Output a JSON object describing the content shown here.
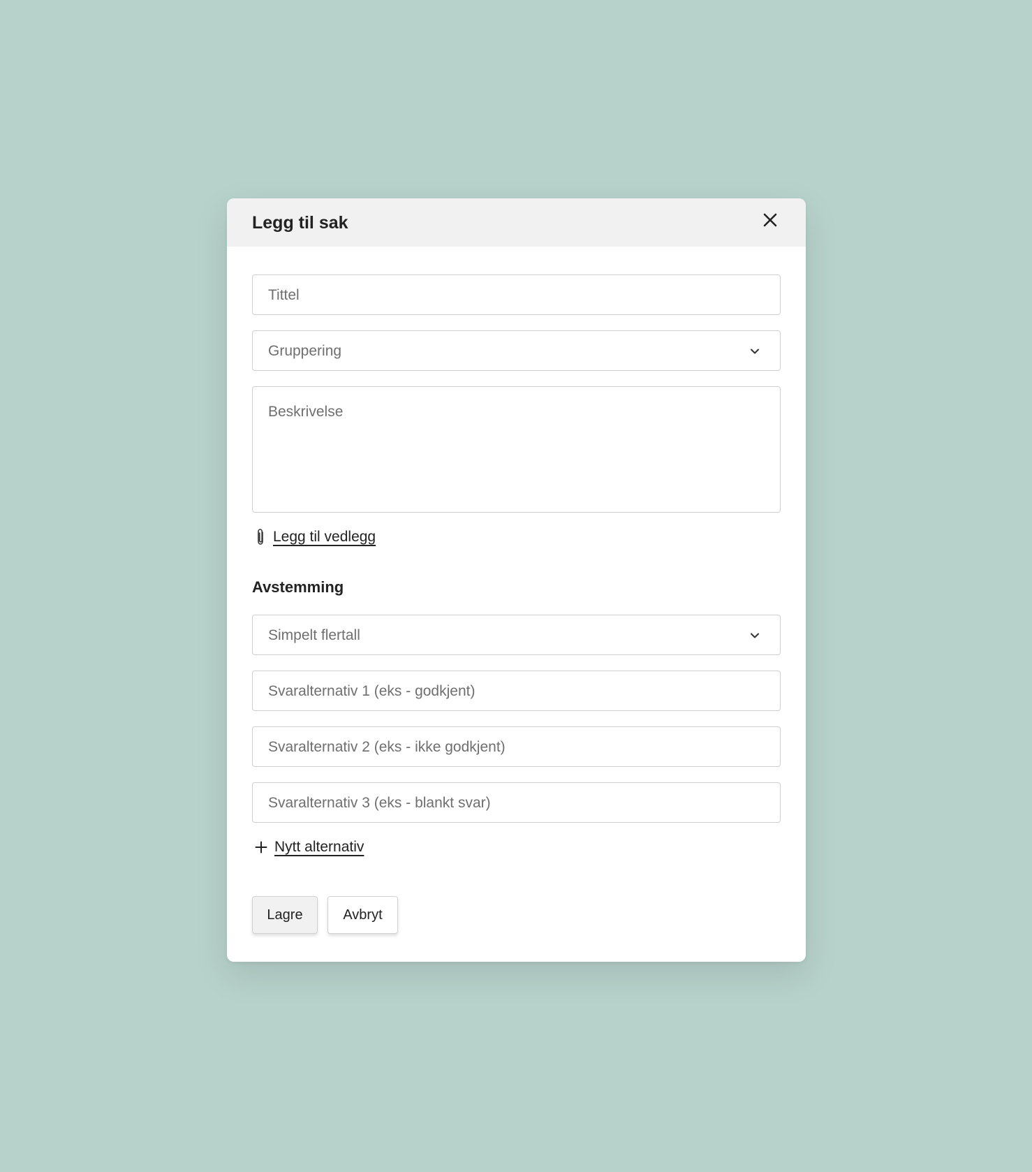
{
  "modal": {
    "title": "Legg til sak",
    "close_icon": "close-icon"
  },
  "form": {
    "title_placeholder": "Tittel",
    "grouping_placeholder": "Gruppering",
    "description_placeholder": "Beskrivelse",
    "attachment_label": "Legg til vedlegg",
    "attachment_icon": "paperclip-icon"
  },
  "voting": {
    "heading": "Avstemming",
    "type_value": "Simpelt flertall",
    "options": [
      "Svaralternativ 1 (eks - godkjent)",
      "Svaralternativ 2 (eks - ikke godkjent)",
      "Svaralternativ 3 (eks - blankt svar)"
    ],
    "add_option_label": "Nytt alternativ",
    "add_option_icon": "plus-icon"
  },
  "actions": {
    "save_label": "Lagre",
    "cancel_label": "Avbryt"
  },
  "colors": {
    "background": "#b7d1cb",
    "header": "#f1f1f1",
    "border": "#cfcfcf",
    "text": "#222222",
    "placeholder": "#6f6f6f"
  }
}
